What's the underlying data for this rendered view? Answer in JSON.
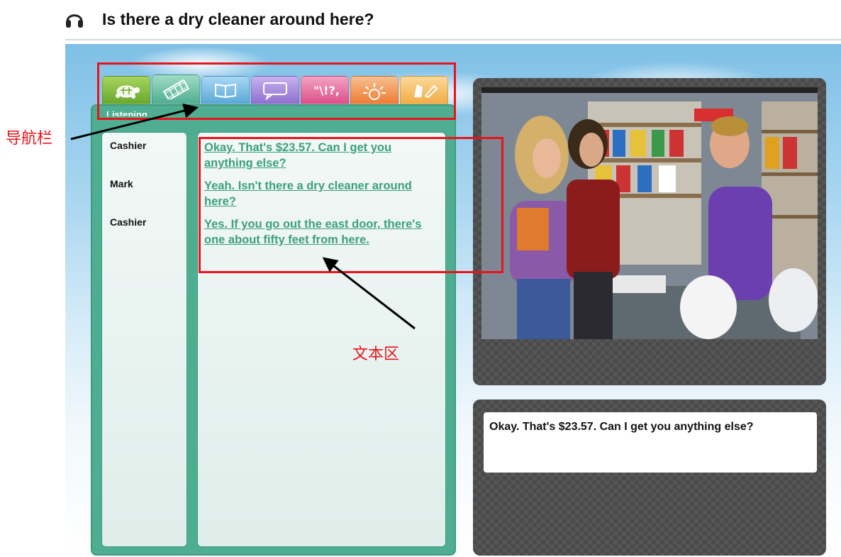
{
  "header": {
    "title": "Is there a dry cleaner around here?",
    "icon": "headphones-icon"
  },
  "tabs": [
    {
      "name": "turtle-icon",
      "color": "#7cb83a",
      "active": false
    },
    {
      "name": "film-icon",
      "color": "#5fb694",
      "active": true
    },
    {
      "name": "book-icon",
      "color": "#64b0dc",
      "active": false
    },
    {
      "name": "speech-bubble-icon",
      "color": "#9b7fd1",
      "active": false
    },
    {
      "name": "sparkle-icon",
      "color": "#e0588f",
      "active": false
    },
    {
      "name": "sun-icon",
      "color": "#f0813d",
      "active": false
    },
    {
      "name": "pencil-hand-icon",
      "color": "#f4b24a",
      "active": false
    }
  ],
  "panel": {
    "label": "Listening"
  },
  "dialog": [
    {
      "speaker": "Cashier",
      "text": "Okay. That's $23.57. Can I get you anything else?"
    },
    {
      "speaker": "Mark",
      "text": "Yeah. Isn't there a dry cleaner around here?"
    },
    {
      "speaker": "Cashier",
      "text": "Yes. If you go out the east door, there's one about fifty feet from here."
    }
  ],
  "caption": {
    "text": "Okay. That's $23.57. Can I get you anything else?"
  },
  "annotations": {
    "nav_label": "导航栏",
    "text_label": "文本区",
    "color": "#e8141b"
  }
}
